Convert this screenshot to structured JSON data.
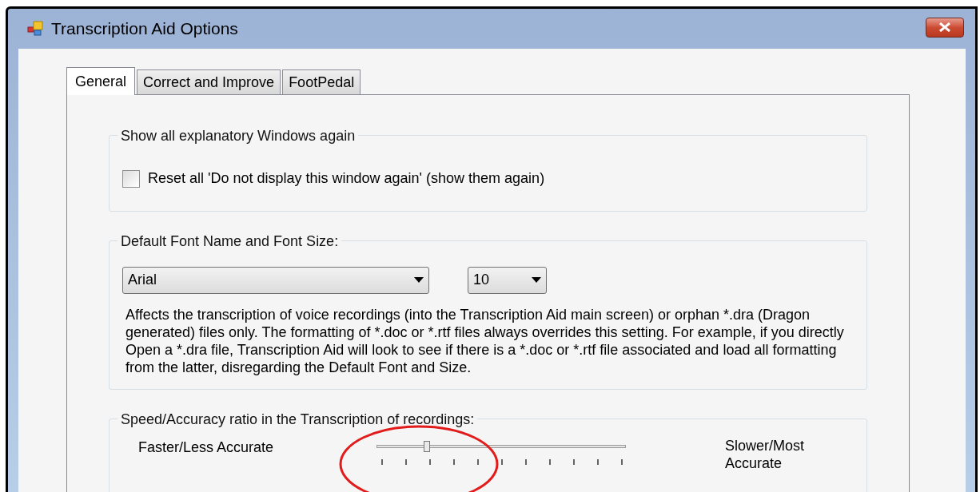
{
  "window": {
    "title": "Transcription Aid Options"
  },
  "tabs": [
    {
      "label": "General",
      "selected": true
    },
    {
      "label": "Correct and Improve",
      "selected": false
    },
    {
      "label": "FootPedal",
      "selected": false
    }
  ],
  "explanatory_group": {
    "title": "Show all explanatory Windows again",
    "checkbox": {
      "label": "Reset all 'Do not display this window again' (show them again)",
      "checked": false
    }
  },
  "font_group": {
    "title": "Default Font Name and Font Size:",
    "font_name": "Arial",
    "font_size": "10",
    "description": "Affects the transcription of voice recordings (into the Transcription Aid main screen) or orphan *.dra (Dragon generated) files only. The formatting of *.doc or *.rtf files always overrides this setting. For example, if you directly Open a *.dra file, Transcription Aid will look to see if there is a *.doc or *.rtf file associated and load all formatting from the latter, disregarding the Default Font and Size."
  },
  "speed_group": {
    "title": "Speed/Accuracy ratio in the Transcription of recordings:",
    "left_label": "Faster/Less Accurate",
    "right_label": "Slower/Most Accurate",
    "slider": {
      "level": 0.2
    }
  },
  "annotation": {
    "highlight_ellipse": true
  }
}
